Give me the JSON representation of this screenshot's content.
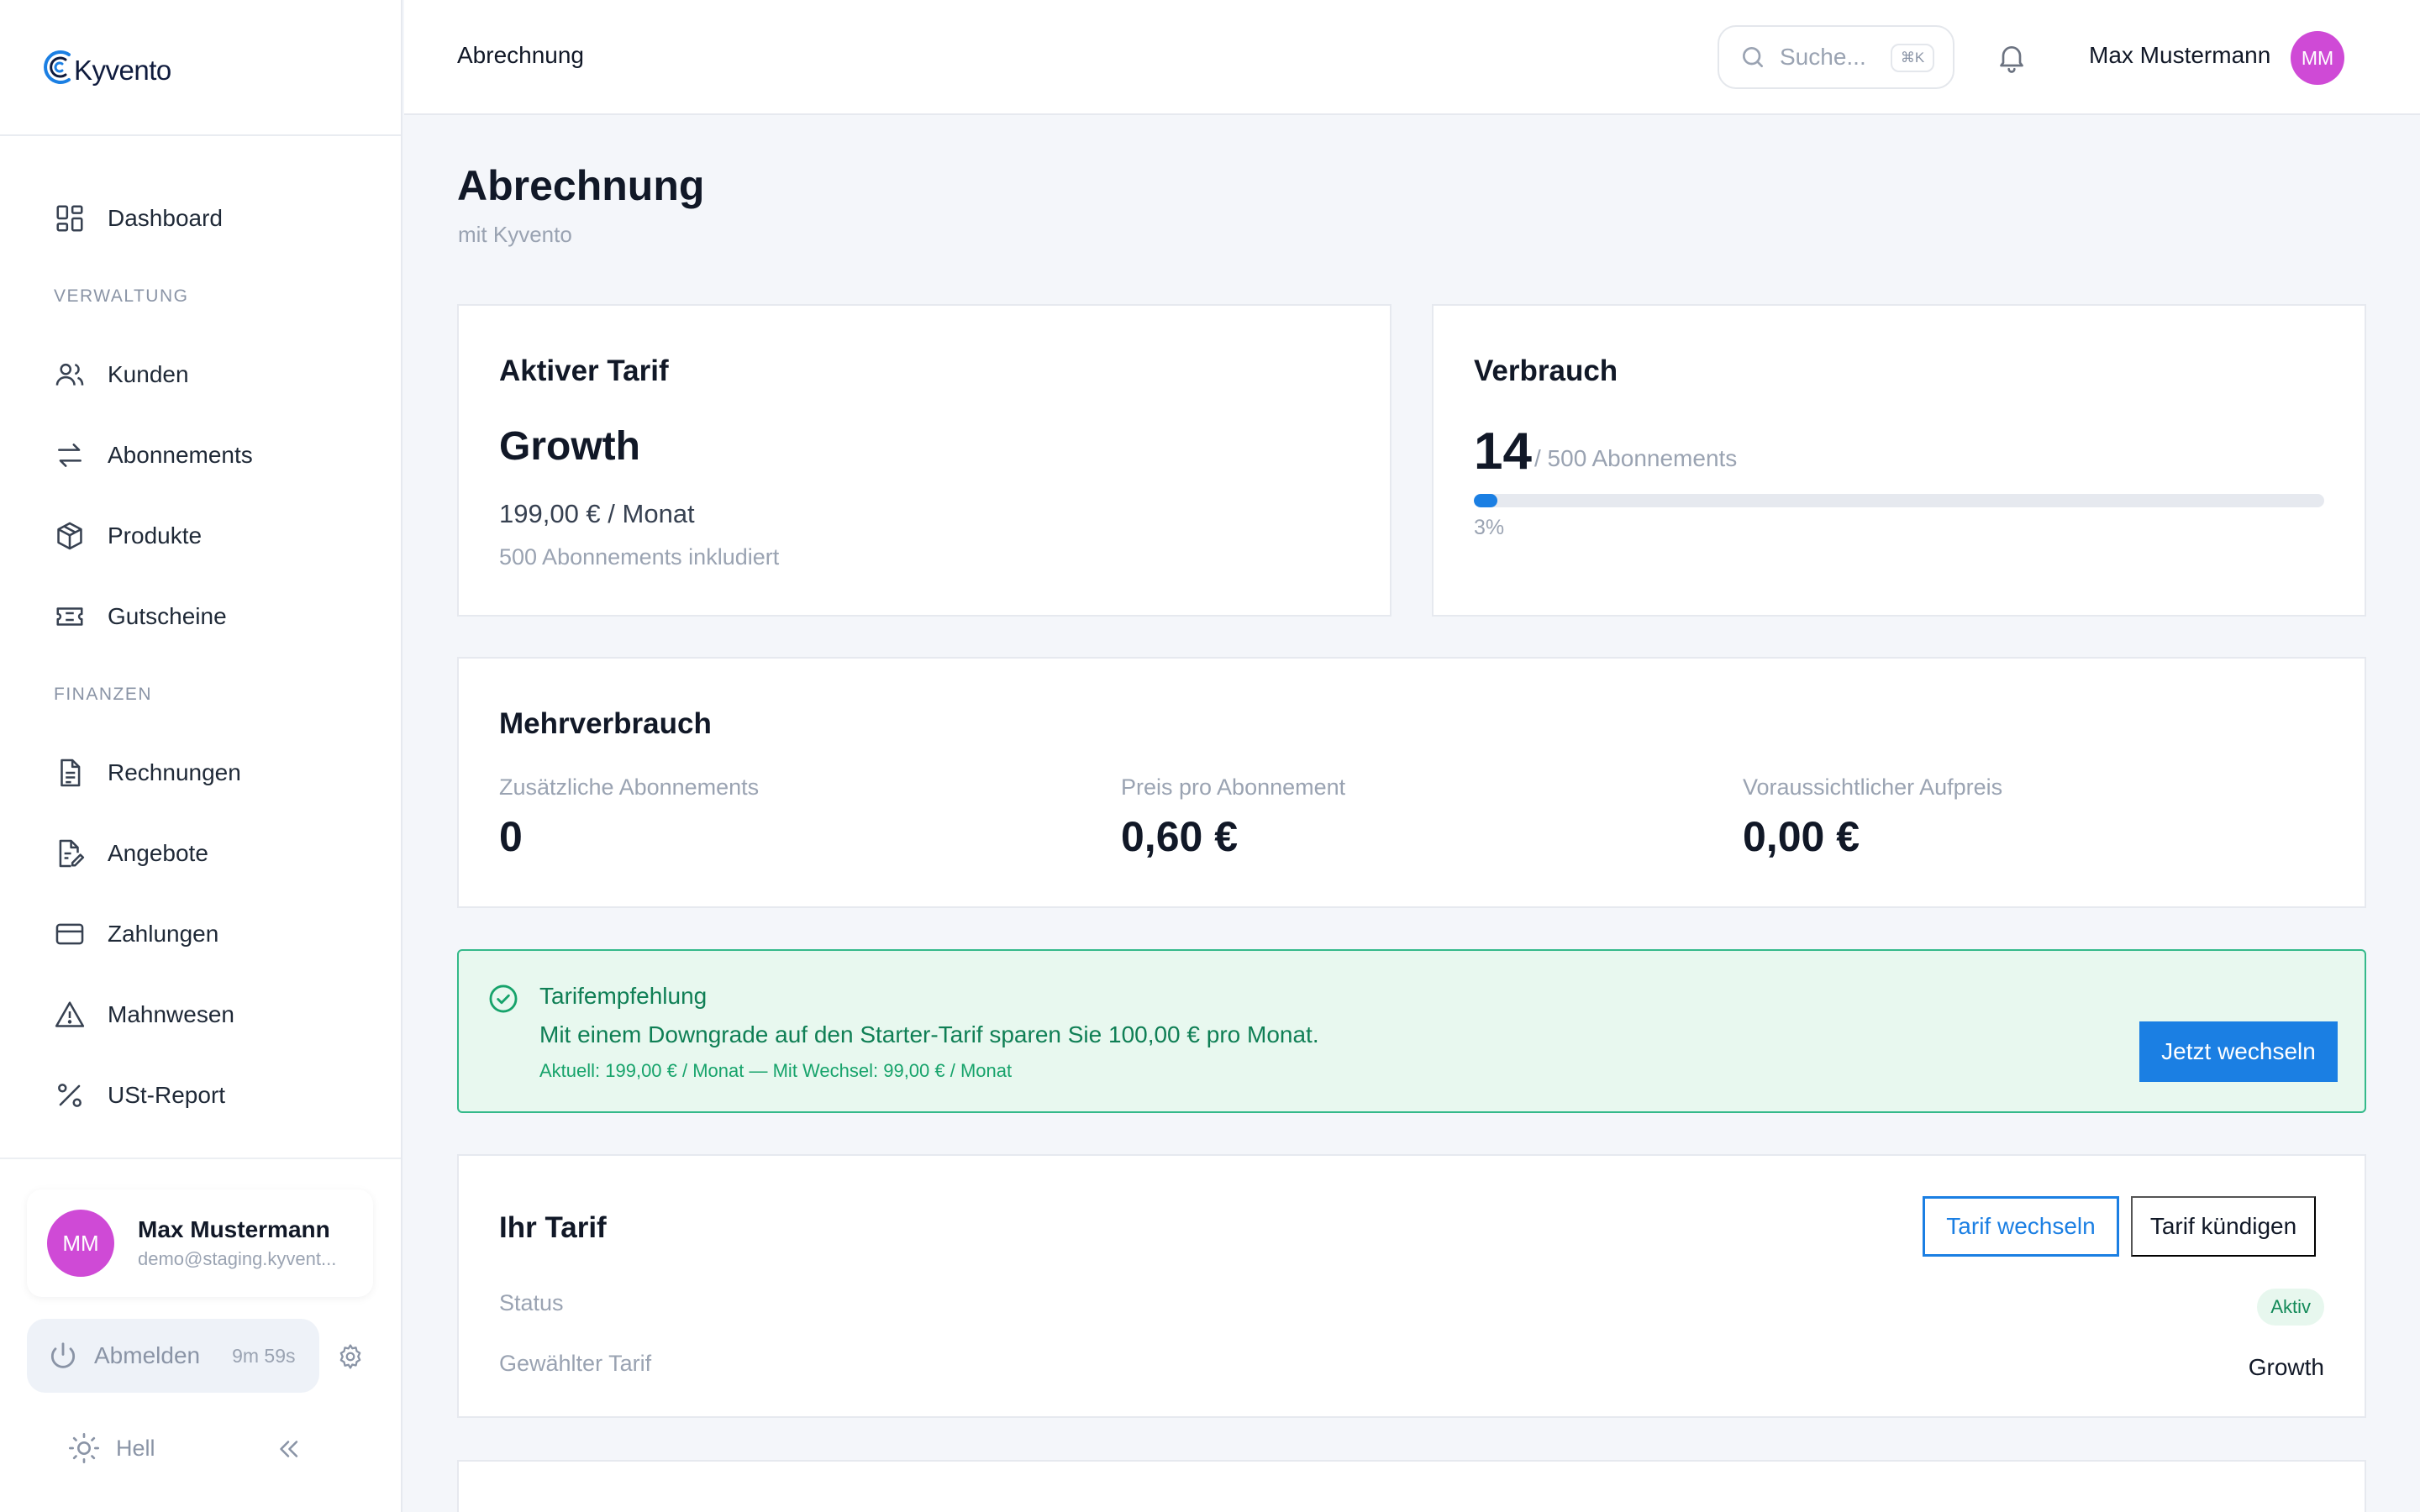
{
  "brand": {
    "name": "Kyvento",
    "accent": "#1b7fe3",
    "avatar_color": "#cf4ad6",
    "success": "#17a36b"
  },
  "sidebar": {
    "items_top": [
      {
        "label": "Dashboard",
        "icon": "dashboard-icon"
      }
    ],
    "section_admin": "VERWALTUNG",
    "items_admin": [
      {
        "label": "Kunden",
        "icon": "users-icon"
      },
      {
        "label": "Abonnements",
        "icon": "repeat-icon"
      },
      {
        "label": "Produkte",
        "icon": "box-icon"
      },
      {
        "label": "Gutscheine",
        "icon": "ticket-icon"
      }
    ],
    "section_finance": "FINANZEN",
    "items_finance": [
      {
        "label": "Rechnungen",
        "icon": "invoice-icon"
      },
      {
        "label": "Angebote",
        "icon": "quote-icon"
      },
      {
        "label": "Zahlungen",
        "icon": "card-icon"
      },
      {
        "label": "Mahnwesen",
        "icon": "warning-icon"
      },
      {
        "label": "USt-Report",
        "icon": "percent-icon"
      }
    ],
    "user": {
      "initials": "MM",
      "name": "Max Mustermann",
      "email": "demo@staging.kyvent..."
    },
    "logout_label": "Abmelden",
    "session_timer": "9m 59s",
    "theme_label": "Hell"
  },
  "topbar": {
    "breadcrumb": "Abrechnung",
    "search_placeholder": "Suche...",
    "search_shortcut": "⌘K",
    "user_name": "Max Mustermann",
    "user_initials": "MM"
  },
  "page": {
    "title": "Abrechnung",
    "subtitle": "mit Kyvento"
  },
  "active_plan": {
    "title": "Aktiver Tarif",
    "name": "Growth",
    "price": "199,00 € / Monat",
    "included": "500 Abonnements inkludiert"
  },
  "usage": {
    "title": "Verbrauch",
    "current": "14",
    "limit_text": "/ 500 Abonnements",
    "percent_text": "3%",
    "fraction": 0.028
  },
  "overage": {
    "title": "Mehrverbrauch",
    "metrics": [
      {
        "label": "Zusätzliche Abonnements",
        "value": "0"
      },
      {
        "label": "Preis pro Abonnement",
        "value": "0,60 €"
      },
      {
        "label": "Voraussichtlicher Aufpreis",
        "value": "0,00 €"
      }
    ]
  },
  "recommendation": {
    "title": "Tarifempfehlung",
    "text": "Mit einem Downgrade auf den Starter-Tarif sparen Sie 100,00 € pro Monat.",
    "detail": "Aktuell: 199,00 € / Monat — Mit Wechsel: 99,00 € / Monat",
    "button": "Jetzt wechseln"
  },
  "your_plan": {
    "title": "Ihr Tarif",
    "change_button": "Tarif wechseln",
    "cancel_button": "Tarif kündigen",
    "status_label": "Status",
    "status_value": "Aktiv",
    "plan_label": "Gewählter Tarif",
    "plan_value": "Growth"
  }
}
